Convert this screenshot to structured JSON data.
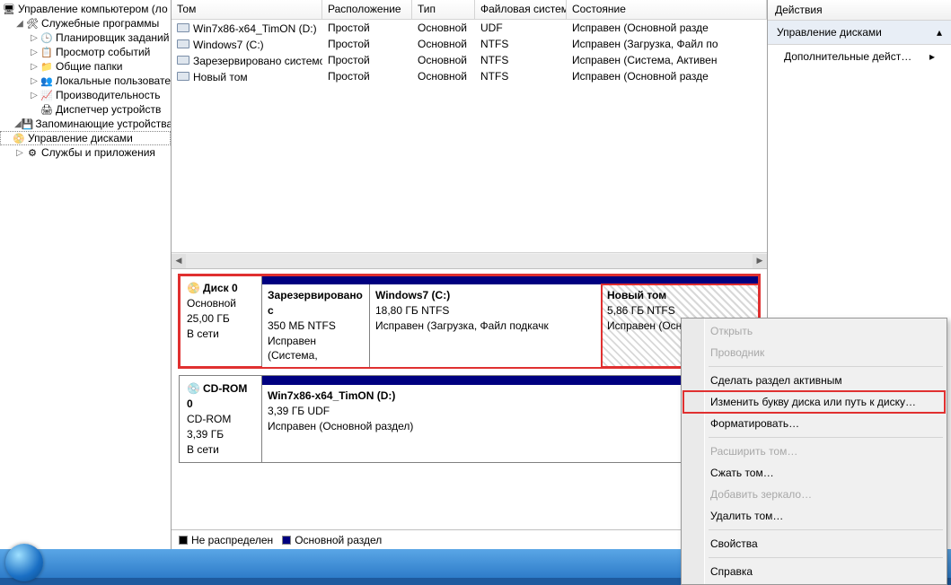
{
  "tree": {
    "root": "Управление компьютером (ло",
    "sys_tools": "Служебные программы",
    "task_sched": "Планировщик заданий",
    "event_viewer": "Просмотр событий",
    "shared_folders": "Общие папки",
    "local_users": "Локальные пользовате",
    "performance": "Производительность",
    "dev_mgr": "Диспетчер устройств",
    "storage": "Запоминающие устройства",
    "disk_mgmt": "Управление дисками",
    "services": "Службы и приложения"
  },
  "vol_header": {
    "tom": "Том",
    "loc": "Расположение",
    "type": "Тип",
    "fs": "Файловая система",
    "state": "Состояние"
  },
  "vols": [
    {
      "tom": "Win7x86-x64_TimON (D:)",
      "loc": "Простой",
      "type": "Основной",
      "fs": "UDF",
      "state": "Исправен (Основной разде"
    },
    {
      "tom": "Windows7 (C:)",
      "loc": "Простой",
      "type": "Основной",
      "fs": "NTFS",
      "state": "Исправен (Загрузка, Файл по"
    },
    {
      "tom": "Зарезервировано системой",
      "loc": "Простой",
      "type": "Основной",
      "fs": "NTFS",
      "state": "Исправен (Система, Активен"
    },
    {
      "tom": "Новый том",
      "loc": "Простой",
      "type": "Основной",
      "fs": "NTFS",
      "state": "Исправен (Основной разде"
    }
  ],
  "disk0": {
    "title": "Диск 0",
    "kind": "Основной",
    "size": "25,00 ГБ",
    "status": "В сети",
    "p0": {
      "title": "Зарезервировано с",
      "size": "350 МБ NTFS",
      "status": "Исправен (Система,"
    },
    "p1": {
      "title": "Windows7  (C:)",
      "size": "18,80 ГБ NTFS",
      "status": "Исправен (Загрузка, Файл подкачк"
    },
    "p2": {
      "title": "Новый том",
      "size": "5,86 ГБ NTFS",
      "status": "Исправен (Основной р"
    }
  },
  "cdrom": {
    "title": "CD-ROM 0",
    "kind": "CD-ROM",
    "size": "3,39 ГБ",
    "status": "В сети",
    "p0": {
      "title": "Win7x86-x64_TimON (D:)",
      "size": "3,39 ГБ UDF",
      "status": "Исправен (Основной раздел)"
    }
  },
  "legend": {
    "unalloc": "Не распределен",
    "primary": "Основной раздел"
  },
  "actions": {
    "header": "Действия",
    "section": "Управление дисками",
    "more": "Дополнительные дейст…"
  },
  "ctx": {
    "open": "Открыть",
    "explorer": "Проводник",
    "make_active": "Сделать раздел активным",
    "change_letter": "Изменить букву диска или путь к диску…",
    "format": "Форматировать…",
    "extend": "Расширить том…",
    "shrink": "Сжать том…",
    "mirror": "Добавить зеркало…",
    "delete": "Удалить том…",
    "properties": "Свойства",
    "help": "Справка"
  }
}
